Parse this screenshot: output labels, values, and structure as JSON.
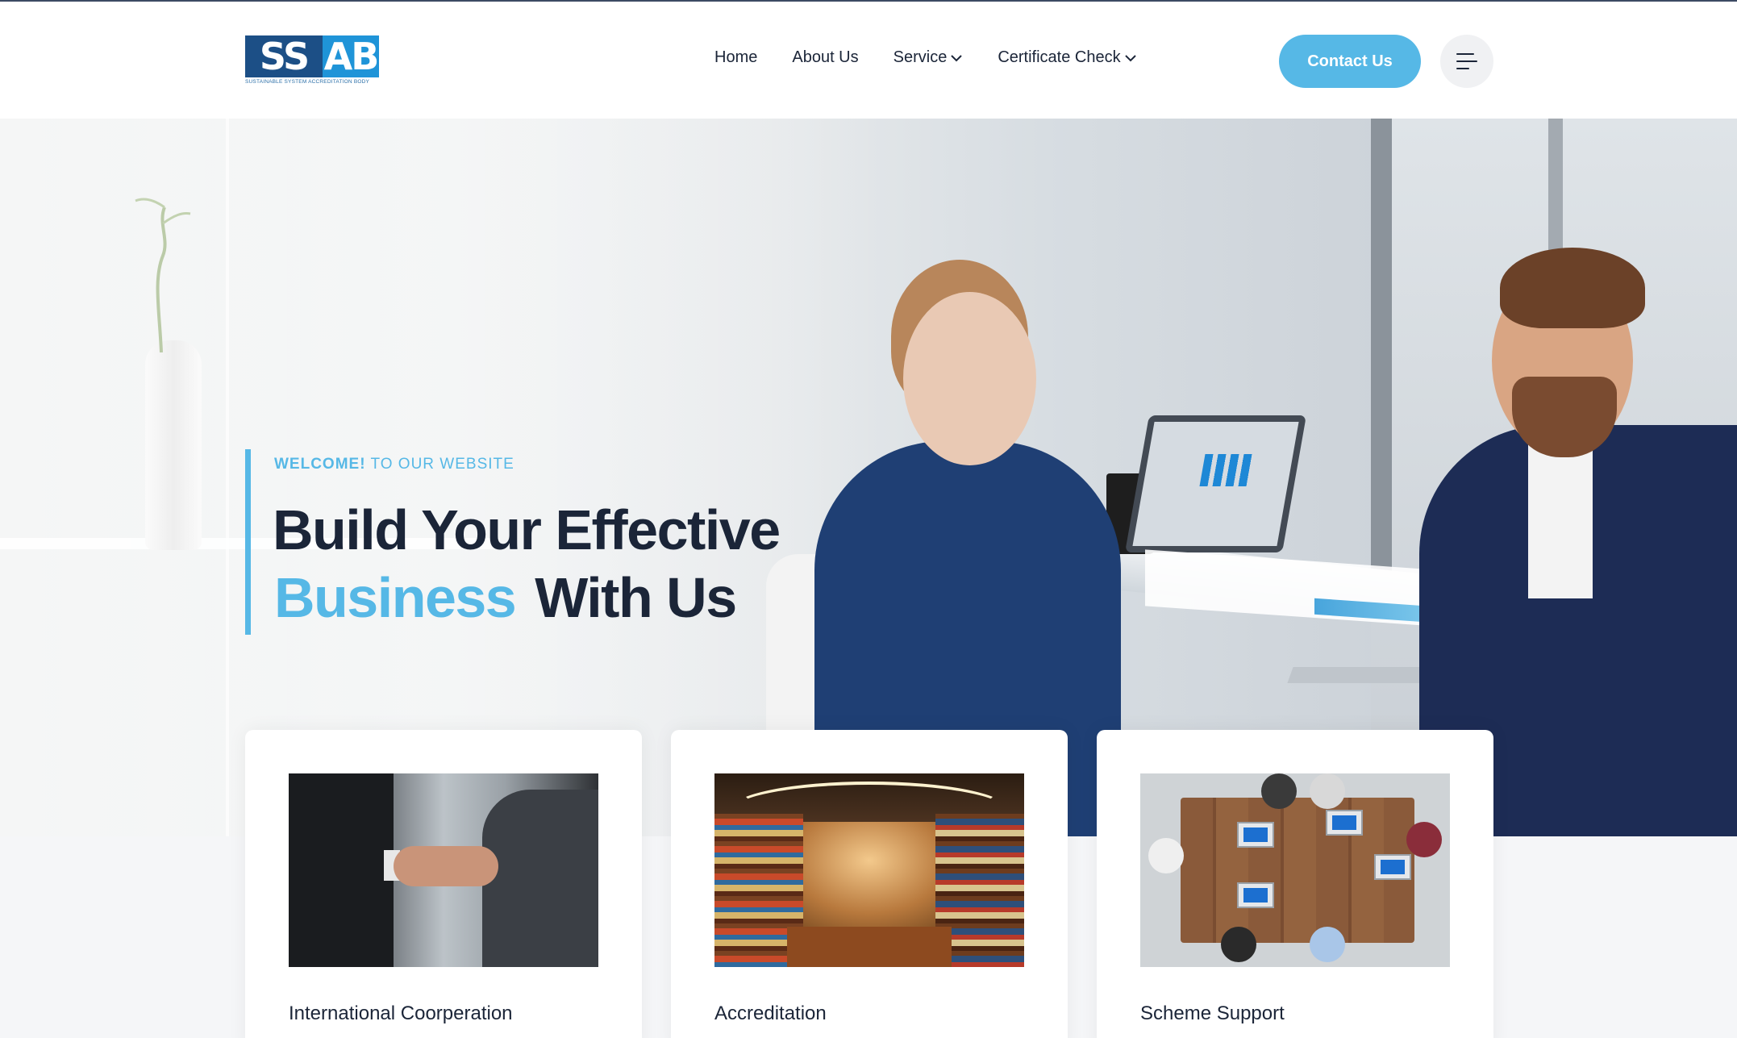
{
  "logo": {
    "left": "SS",
    "right": "AB",
    "tagline": "SUSTAINABLE SYSTEM ACCREDITATION BODY"
  },
  "nav": {
    "items": [
      {
        "label": "Home",
        "dropdown": false
      },
      {
        "label": "About Us",
        "dropdown": false
      },
      {
        "label": "Service",
        "dropdown": true
      },
      {
        "label": "Certificate Check",
        "dropdown": true
      }
    ],
    "contact_button": "Contact Us",
    "menu_icon": "hamburger-menu-icon"
  },
  "hero": {
    "welcome_bold": "WELCOME!",
    "welcome_rest": " TO OUR WEBSITE",
    "headline_line1": "Build Your Effective",
    "headline_highlight": "Business",
    "headline_line2_rest": "With Us"
  },
  "cards": [
    {
      "title": "International Coorperation",
      "image": "handshake-photo"
    },
    {
      "title": "Accreditation",
      "image": "library-photo"
    },
    {
      "title": "Scheme Support",
      "image": "team-meeting-photo"
    }
  ],
  "colors": {
    "accent": "#56b8e6",
    "heading": "#1b2538",
    "logo_dark": "#1c4f86",
    "logo_light": "#1f94d8"
  }
}
